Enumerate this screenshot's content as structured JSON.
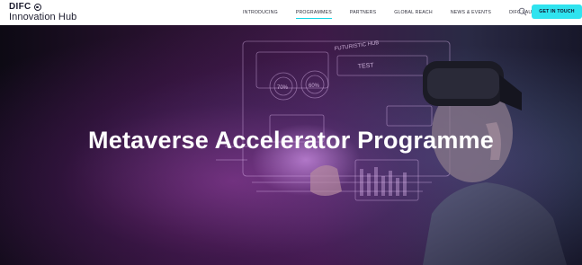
{
  "header": {
    "logo_top": "DIFC",
    "logo_bottom": "Innovation Hub",
    "nav": [
      {
        "label": "INTRODUCING"
      },
      {
        "label": "PROGRAMMES"
      },
      {
        "label": "PARTNERS"
      },
      {
        "label": "GLOBAL REACH"
      },
      {
        "label": "NEWS & EVENTS"
      },
      {
        "label": "DIFC LAUNCHPAD"
      }
    ],
    "active_nav": "PROGRAMMES",
    "search_icon": "search-icon",
    "cta_label": "GET IN TOUCH"
  },
  "hero": {
    "title": "Metaverse Accelerator Programme",
    "hud_labels": {
      "futuristic": "FUTURISTIC HUB",
      "test": "TEST",
      "pct_left": "70%",
      "pct_right": "60%"
    }
  },
  "colors": {
    "accent": "#2fe3ef",
    "text_dark": "#1c1c2e",
    "hero_base": "#2a1231"
  }
}
